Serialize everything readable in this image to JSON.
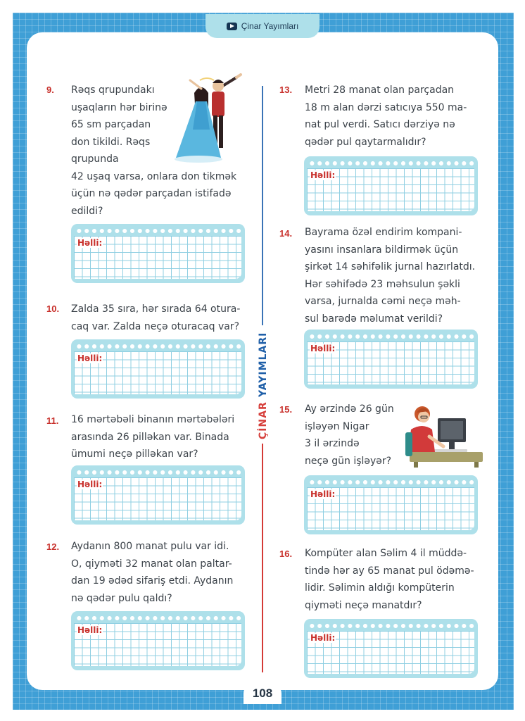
{
  "header": {
    "brand": "Çinar Yayımları"
  },
  "spine": {
    "part1": "ÇİNAR",
    "part2": "YAYIMLARI"
  },
  "answer_label": "Həlli:",
  "page_number": "108",
  "problems": [
    {
      "number": "9.",
      "lines": [
        "Rəqs qrupundakı",
        "uşaqların hər birinə",
        "65 sm parçadan",
        "don tikildi. Rəqs",
        "qrupunda",
        "42 uşaq varsa, onlara don tikmək",
        "üçün nə qədər parçadan istifadə",
        "edildi?"
      ]
    },
    {
      "number": "10.",
      "lines": [
        "Zalda 35 sıra, hər sırada 64 otura-",
        "caq var. Zalda neçə oturacaq var?"
      ]
    },
    {
      "number": "11.",
      "lines": [
        "16 mərtəbəli binanın mərtəbələri",
        "arasında 26 pilləkan var. Binada",
        "ümumi neçə pilləkan var?"
      ]
    },
    {
      "number": "12.",
      "lines": [
        "Aydanın 800 manat pulu var idi.",
        "O, qiyməti 32 manat olan paltar-",
        "dan 19 ədəd sifariş etdi. Aydanın",
        "nə qədər pulu qaldı?"
      ]
    },
    {
      "number": "13.",
      "lines": [
        "Metri 28 manat olan parçadan",
        "18 m alan dərzi satıcıya 550 ma-",
        "nat pul verdi. Satıcı dərziyə nə",
        "qədər pul qaytarmalıdır?"
      ]
    },
    {
      "number": "14.",
      "lines": [
        "Bayrama özəl endirim kompani-",
        "yasını insanlara bildirmək üçün",
        "şirkət 14 səhifəlik jurnal hazırlatdı.",
        "Hər səhifədə 23 məhsulun şəkli",
        "varsa, jurnalda cəmi neçə məh-",
        "sul barədə məlumat verildi?"
      ]
    },
    {
      "number": "15.",
      "lines": [
        "Ay ərzində 26 gün",
        "işləyən Nigar",
        "3 il ərzində",
        "neçə gün işləyər?"
      ]
    },
    {
      "number": "16.",
      "lines": [
        "Kompüter alan Səlim 4 il müddə-",
        "tində hər ay 65 manat pul ödəmə-",
        "lidir. Səlimin aldığı kompüterin",
        "qiyməti neçə manatdır?"
      ]
    }
  ],
  "illustrations": {
    "dancers": "dancing-couple-illustration",
    "office": "woman-at-computer-illustration"
  },
  "colors": {
    "frame": "#3f9fd6",
    "number_red": "#c8302b",
    "box": "#aee0ea",
    "spine_blue": "#1f5fa8",
    "spine_red": "#d63f3b"
  }
}
